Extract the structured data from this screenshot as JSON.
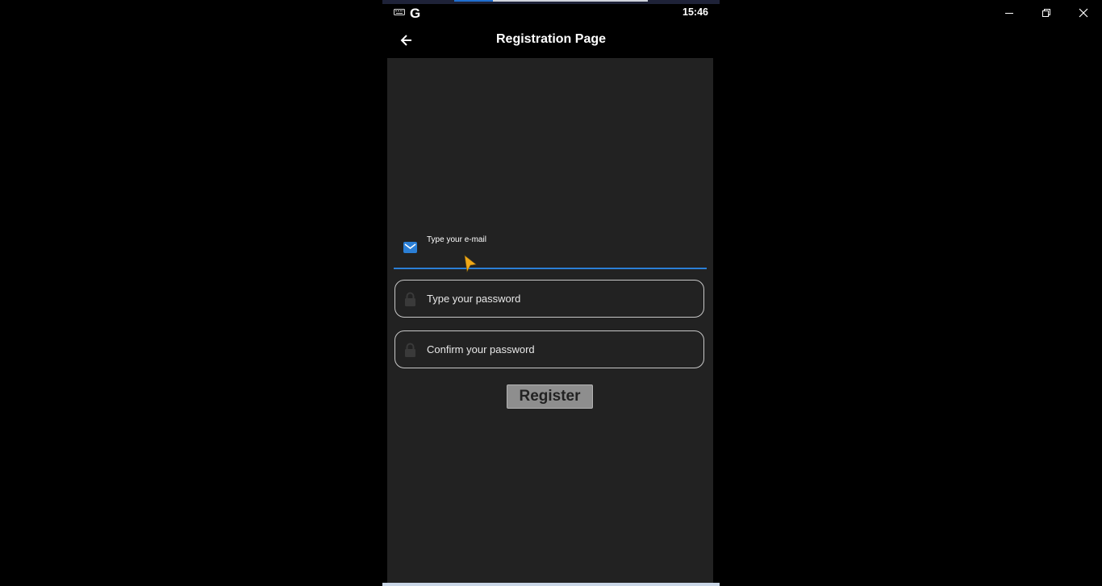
{
  "window": {
    "controls": [
      "minimize-icon",
      "restore-icon",
      "close-icon"
    ]
  },
  "status_bar": {
    "icons": [
      "keyboard-icon",
      "google-icon"
    ],
    "google_glyph": "G",
    "time": "15:46"
  },
  "app_bar": {
    "back_icon": "arrow-left-icon",
    "title": "Registration Page"
  },
  "form": {
    "email": {
      "label": "Type your e-mail",
      "value": "",
      "icon": "mail-icon",
      "state": "focused"
    },
    "password": {
      "placeholder": "Type your password",
      "value": "",
      "icon": "lock-icon"
    },
    "confirm_password": {
      "placeholder": "Confirm your password",
      "value": "",
      "icon": "lock-icon"
    },
    "register_label": "Register"
  },
  "colors": {
    "accent": "#2b7fd6",
    "background": "#222222",
    "button": "#8e8e8e",
    "cursor": "#f0a818"
  }
}
